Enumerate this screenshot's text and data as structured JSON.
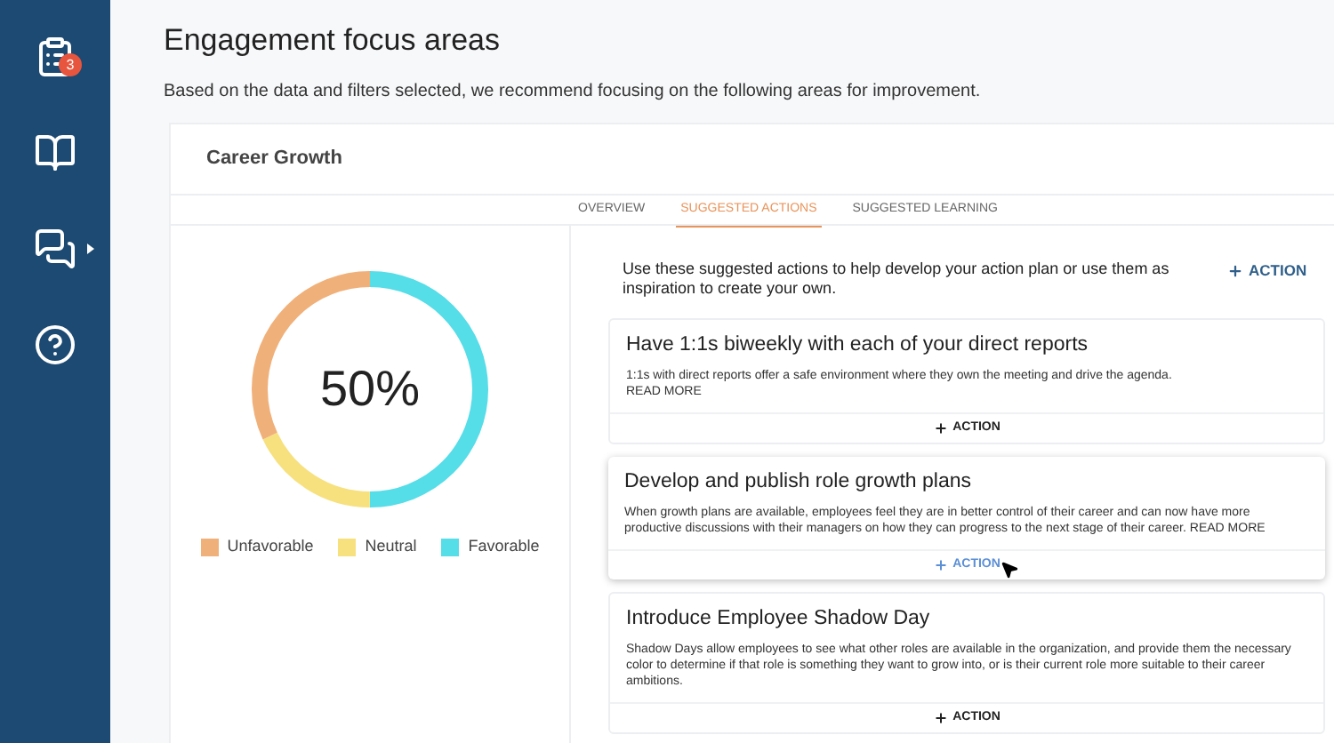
{
  "sidebar": {
    "items": [
      {
        "kind": "clipboard",
        "badge": "3"
      },
      {
        "kind": "book"
      },
      {
        "kind": "chat",
        "submenu": true
      },
      {
        "kind": "help"
      }
    ]
  },
  "header": {
    "title": "Engagement focus areas",
    "subtitle": "Based on the data and filters selected, we recommend focusing on the following areas for improvement."
  },
  "card": {
    "title": "Career Growth",
    "tabs": [
      {
        "label": "OVERVIEW",
        "selected": false
      },
      {
        "label": "SUGGESTED ACTIONS",
        "selected": true
      },
      {
        "label": "SUGGESTED LEARNING",
        "selected": false
      }
    ],
    "score": "50%",
    "legend": [
      {
        "label": "Unfavorable",
        "color": "#f0b07a"
      },
      {
        "label": "Neutral",
        "color": "#f7e17e"
      },
      {
        "label": "Favorable",
        "color": "#55dde8"
      }
    ],
    "intro": "Use these suggested actions to help develop your action plan or use them as inspiration to create your own.",
    "intro_action": "ACTION",
    "actions": [
      {
        "title": "Have 1:1s biweekly with each of your direct reports",
        "text": "1:1s with direct reports offer a safe environment where they own the meeting and drive the agenda.",
        "read_more": "READ MORE",
        "read_more_newline": true,
        "button": "ACTION",
        "hovered": false
      },
      {
        "title": "Develop and publish role growth plans",
        "text": "When growth plans are available, employees feel they are in better control of their career and can now have more productive discussions with their managers on how they can progress to the next stage of their career.",
        "read_more": "READ MORE",
        "read_more_newline": false,
        "button": "ACTION",
        "hovered": true
      },
      {
        "title": "Introduce Employee Shadow Day",
        "text": "Shadow Days allow employees to see what other roles are available in the organization, and provide them the necessary color to determine if that role is something they want to grow into, or is their current role more suitable to their career ambitions.",
        "button": "ACTION",
        "hovered": false
      }
    ]
  }
}
